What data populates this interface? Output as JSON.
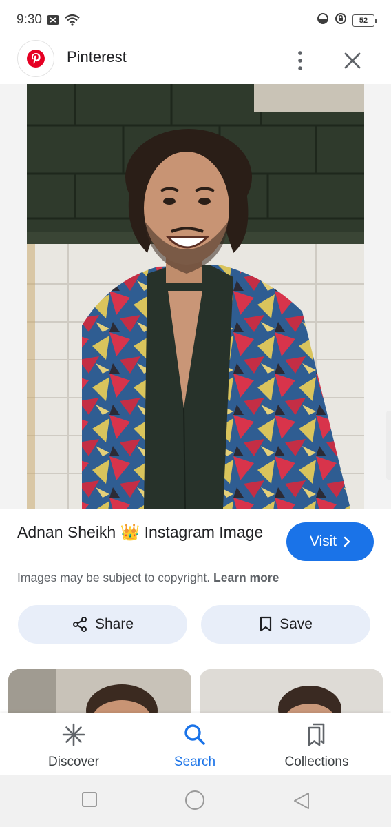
{
  "status_bar": {
    "time": "9:30",
    "battery_level": "52",
    "icons": [
      "notification-icon",
      "wifi-icon",
      "data-saver-icon",
      "lock-rotation-icon",
      "battery-icon"
    ]
  },
  "header": {
    "site_name": "Pinterest",
    "favicon": "pinterest-logo-icon",
    "more_icon": "more-vert-icon",
    "close_icon": "close-icon"
  },
  "image": {
    "title": "Adnan Sheikh 👑 Instagram Image"
  },
  "visit_button": {
    "label": "Visit"
  },
  "copyright": {
    "text": "Images may be subject to copyright.",
    "link": "Learn more"
  },
  "actions": {
    "share_label": "Share",
    "save_label": "Save"
  },
  "bottom_nav": {
    "items": [
      {
        "label": "Discover",
        "icon": "discover-asterisk-icon",
        "active": false
      },
      {
        "label": "Search",
        "icon": "search-icon",
        "active": true
      },
      {
        "label": "Collections",
        "icon": "collections-icon",
        "active": false
      }
    ]
  },
  "colors": {
    "accent": "#1a73e8",
    "pill_bg": "#e8eef9",
    "pinterest_red": "#e60023"
  }
}
